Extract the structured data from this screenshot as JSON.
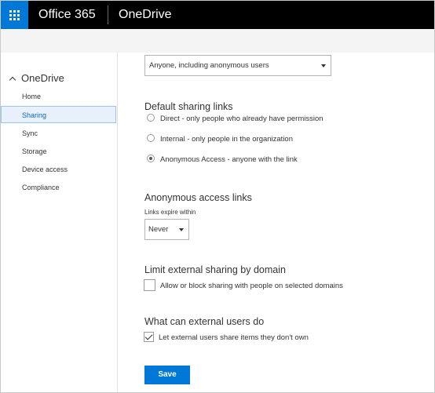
{
  "suite": {
    "brand": "Office 365",
    "app_name": "OneDrive"
  },
  "nav": {
    "header": "OneDrive",
    "items": [
      {
        "label": "Home",
        "selected": false
      },
      {
        "label": "Sharing",
        "selected": true
      },
      {
        "label": "Sync",
        "selected": false
      },
      {
        "label": "Storage",
        "selected": false
      },
      {
        "label": "Device access",
        "selected": false
      },
      {
        "label": "Compliance",
        "selected": false
      }
    ]
  },
  "main": {
    "external_sharing_select": "Anyone, including anonymous users",
    "default_links": {
      "title": "Default sharing links",
      "options": [
        {
          "label": "Direct - only people who already have permission",
          "checked": false
        },
        {
          "label": "Internal - only people in the organization",
          "checked": false
        },
        {
          "label": "Anonymous Access - anyone with the link",
          "checked": true
        }
      ]
    },
    "anonymous_links": {
      "title": "Anonymous access links",
      "expire_label": "Links expire within",
      "expire_value": "Never"
    },
    "limit_domain": {
      "title": "Limit external sharing by domain",
      "checkbox_label": "Allow or block sharing with people on selected domains",
      "checked": false
    },
    "external_users": {
      "title": "What can external users do",
      "checkbox_label": "Let external users share items they don't own",
      "checked": true
    },
    "save_label": "Save"
  },
  "colors": {
    "accent": "#0078d7",
    "topbar": "#000000",
    "selected_bg": "#e8f1fb"
  }
}
